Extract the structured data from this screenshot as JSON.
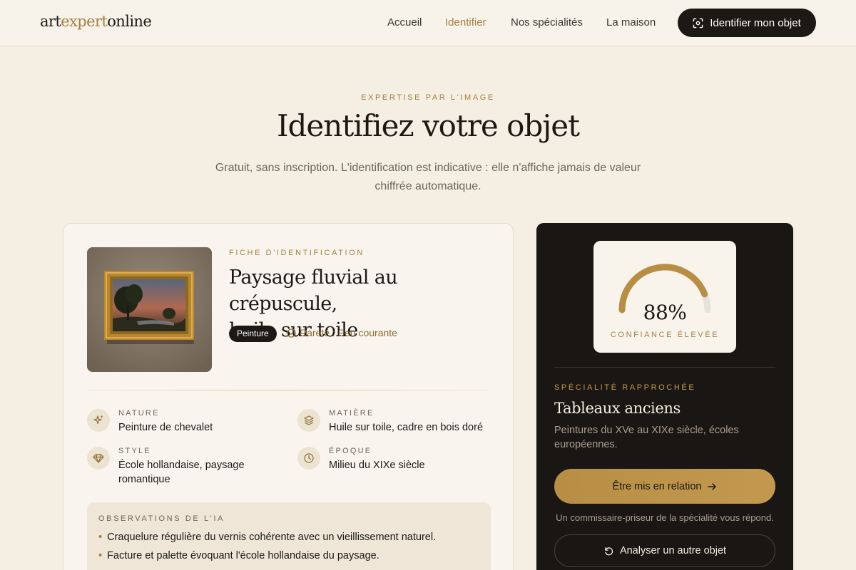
{
  "header": {
    "logo_part1": "art",
    "logo_part2": "expert",
    "logo_part3": "online",
    "nav": [
      "Accueil",
      "Identifier",
      "Nos spécialités",
      "La maison"
    ],
    "active_nav": "Identifier",
    "cta_label": "Identifier mon objet",
    "cta_icon": "scan-icon"
  },
  "hero": {
    "eyebrow": "EXPERTISE PAR L'IMAGE",
    "title": "Identifiez votre objet",
    "subtitle_line1": "Gratuit, sans inscription. L'identification est indicative : elle n'affiche jamais de valeur",
    "subtitle_line2": "chiffrée automatique."
  },
  "card": {
    "eyebrow": "FICHE D'IDENTIFICATION",
    "title_line1": "Paysage fluvial au crépuscule,",
    "title_line2": "huile sur toile",
    "tag": "Peinture",
    "rarity": "Rareté : Peu courante",
    "attributes": [
      {
        "label": "NATURE",
        "value": "Peinture de chevalet",
        "icon": "sparkle-icon"
      },
      {
        "label": "MATIÈRE",
        "value": "Huile sur toile, cadre en bois doré",
        "icon": "layers-icon"
      },
      {
        "label": "STYLE",
        "value_line1": "École hollandaise, paysage",
        "value_line2": "romantique",
        "icon": "diamond-icon"
      },
      {
        "label": "ÉPOQUE",
        "value": "Milieu du XIXe siècle",
        "icon": "clock-icon"
      }
    ],
    "observations": {
      "title": "OBSERVATIONS DE L'IA",
      "items": [
        "Craquelure régulière du vernis cohérente avec un vieillissement naturel.",
        "Facture et palette évoquant l'école hollandaise du paysage."
      ]
    }
  },
  "panel": {
    "confidence_percent": 88,
    "confidence_text": "88%",
    "confidence_label": "CONFIANCE ÉLEVÉE",
    "specialty_eyebrow": "SPÉCIALITÉ RAPPROCHÉE",
    "specialty_title": "Tableaux anciens",
    "specialty_desc": "Peintures du XVe au XIXe siècle, écoles européennes.",
    "contact_button": "Être mis en relation",
    "note": "Un commissaire-priseur de la spécialité vous répond.",
    "reanalyze_button": "Analyser un autre objet"
  },
  "colors": {
    "accent_gold": "#a3803f",
    "dark": "#1c1814",
    "background": "#f5efe3"
  }
}
